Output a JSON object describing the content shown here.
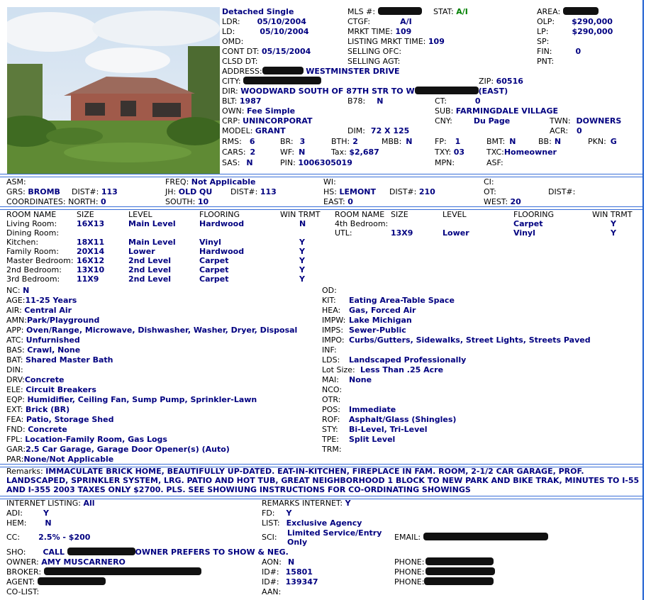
{
  "header": {
    "type": "Detached Single",
    "mls_label": "MLS #:",
    "stat_label": "STAT:",
    "stat_value": "A/I",
    "area_label": "AREA:",
    "ldr_label": "LDR:",
    "ldr_value": "05/10/2004",
    "ctgf_label": "CTGF:",
    "ctgf_value": "A/I",
    "olp_label": "OLP:",
    "olp_value": "$290,000",
    "ld_label": "LD:",
    "ld_value": "05/10/2004",
    "mrkt_label": "MRKT TIME:",
    "mrkt_value": "109",
    "lp_label": "LP:",
    "lp_value": "$290,000",
    "omd_label": "OMD:",
    "lmt_label": "LISTING MRKT TIME:",
    "lmt_value": "109",
    "sp_label": "SP:",
    "cont_label": "CONT DT:",
    "cont_value": "05/15/2004",
    "sofc_label": "SELLING OFC:",
    "fin_label": "FIN:",
    "fin_value": "0",
    "clsd_label": "CLSD DT:",
    "sagt_label": "SELLING AGT:",
    "pnt_label": "PNT:",
    "address_label": "ADDRESS:",
    "address_value": "WESTMINSTER DRIVE",
    "city_label": "CITY:",
    "zip_label": "ZIP:",
    "zip_value": "60516",
    "dir_label": "DIR:",
    "dir_value": "WOODWARD SOUTH OF 87TH STR TO W",
    "dir_end": "(EAST)",
    "blt_label": "BLT:",
    "blt_value": "1987",
    "b78_label": "B78:",
    "b78_value": "N",
    "ct_label": "CT:",
    "ct_value": "0",
    "own_label": "OWN:",
    "own_value": "Fee Simple",
    "sub_label": "SUB:",
    "sub_value": "FARMINGDALE VILLAGE",
    "crp_label": "CRP:",
    "crp_value": "UNINCORPORAT",
    "cny_label": "CNY:",
    "cny_value": "Du Page",
    "twn_label": "TWN:",
    "twn_value": "DOWNERS",
    "model_label": "MODEL:",
    "model_value": "GRANT",
    "dim_label": "DIM:",
    "dim_value": "72 X 125",
    "acr_label": "ACR:",
    "acr_value": "0",
    "rms_label": "RMS:",
    "rms_value": "6",
    "br_label": "BR:",
    "br_value": "3",
    "bth_label": "BTH:",
    "bth_value": "2",
    "mbb_label": "MBB:",
    "mbb_value": "N",
    "fp_label": "FP:",
    "fp_value": "1",
    "bmt_label": "BMT:",
    "bmt_value": "N",
    "bb_label": "BB:",
    "bb_value": "N",
    "pkn_label": "PKN:",
    "pkn_value": "G",
    "cars_label": "CARS:",
    "cars_value": "2",
    "wf_label": "WF:",
    "wf_value": "N",
    "tax_label": "Tax:",
    "tax_value": "$2,687",
    "txy_label": "TXY:",
    "txy_value": "03",
    "txc_label": "TXC:",
    "txc_value": "Homeowner",
    "sas_label": "SAS:",
    "sas_value": "N",
    "pin_label": "PIN:",
    "pin_value": "1006305019",
    "mpn_label": "MPN:",
    "asf_label": "ASF:"
  },
  "school": {
    "asm_label": "ASM:",
    "freq_label": "FREQ:",
    "freq_value": "Not Applicable",
    "wi_label": "WI:",
    "ci_label": "CI:",
    "grs_label": "GRS:",
    "grs_value": "BROMB",
    "dist_label": "DIST#:",
    "grs_dist": "113",
    "jh_label": "JH:",
    "jh_value": "OLD QU",
    "jh_dist": "113",
    "hs_label": "HS:",
    "hs_value": "LEMONT",
    "hs_dist": "210",
    "ot_label": "OT:",
    "ot_dist_label": "DIST#:",
    "coord_label": "COORDINATES: NORTH:",
    "north_value": "0",
    "south_label": "SOUTH:",
    "south_value": "10",
    "east_label": "EAST:",
    "east_value": "0",
    "west_label": "WEST:",
    "west_value": "20"
  },
  "rooms": {
    "headers": [
      "ROOM NAME",
      "SIZE",
      "LEVEL",
      "FLOORING",
      "WIN TRMT"
    ],
    "left": [
      {
        "name": "Living Room:",
        "size": "16X13",
        "level": "Main Level",
        "floor": "Hardwood",
        "win": "N"
      },
      {
        "name": "Dining Room:",
        "size": "",
        "level": "",
        "floor": "",
        "win": ""
      },
      {
        "name": "Kitchen:",
        "size": "18X11",
        "level": "Main Level",
        "floor": "Vinyl",
        "win": "Y"
      },
      {
        "name": "Family Room:",
        "size": "20X14",
        "level": "Lower",
        "floor": "Hardwood",
        "win": "Y"
      },
      {
        "name": "Master Bedroom:",
        "size": "16X12",
        "level": "2nd Level",
        "floor": "Carpet",
        "win": "Y"
      },
      {
        "name": "2nd Bedroom:",
        "size": "13X10",
        "level": "2nd Level",
        "floor": "Carpet",
        "win": "Y"
      },
      {
        "name": "3rd Bedroom:",
        "size": "11X9",
        "level": "2nd Level",
        "floor": "Carpet",
        "win": "Y"
      }
    ],
    "right": [
      {
        "name": "4th Bedroom:",
        "size": "",
        "level": "",
        "floor": "Carpet",
        "win": "Y"
      },
      {
        "name": "UTL:",
        "size": "13X9",
        "level": "Lower",
        "floor": "Vinyl",
        "win": "Y"
      }
    ]
  },
  "features_left": [
    {
      "label": "NC:",
      "value": "N"
    },
    {
      "label": "AGE:",
      "value": "11-25 Years"
    },
    {
      "label": "AIR:",
      "value": "Central Air"
    },
    {
      "label": "AMN:",
      "value": "Park/Playground"
    },
    {
      "label": "APP:",
      "value": "Oven/Range, Microwave, Dishwasher, Washer, Dryer, Disposal"
    },
    {
      "label": "ATC:",
      "value": "Unfurnished"
    },
    {
      "label": "BAS:",
      "value": "Crawl, None"
    },
    {
      "label": "BAT:",
      "value": "Shared Master Bath"
    },
    {
      "label": "DIN:",
      "value": ""
    },
    {
      "label": "DRV:",
      "value": "Concrete"
    },
    {
      "label": "ELE:",
      "value": "Circuit Breakers"
    },
    {
      "label": "EQP:",
      "value": "Humidifier, Ceiling Fan, Sump Pump, Sprinkler-Lawn"
    },
    {
      "label": "EXT:",
      "value": "Brick (BR)"
    },
    {
      "label": "FEA:",
      "value": "Patio, Storage Shed"
    },
    {
      "label": "FND:",
      "value": "Concrete"
    },
    {
      "label": "FPL:",
      "value": "Location-Family Room, Gas Logs"
    },
    {
      "label": "GAR:",
      "value": "2.5 Car Garage, Garage Door Opener(s) (Auto)"
    },
    {
      "label": "PAR:",
      "value": "None/Not Applicable"
    }
  ],
  "features_right": [
    {
      "label": "OD:",
      "value": ""
    },
    {
      "label": "KIT:",
      "value": "Eating Area-Table Space"
    },
    {
      "label": "HEA:",
      "value": "Gas, Forced Air"
    },
    {
      "label": "IMPW:",
      "value": "Lake Michigan"
    },
    {
      "label": "IMPS:",
      "value": "Sewer-Public"
    },
    {
      "label": "IMPO:",
      "value": "Curbs/Gutters, Sidewalks, Street Lights, Streets Paved"
    },
    {
      "label": "INF:",
      "value": ""
    },
    {
      "label": "LDS:",
      "value": "Landscaped Professionally"
    },
    {
      "label": "Lot Size:",
      "value": "Less Than .25 Acre"
    },
    {
      "label": "MAI:",
      "value": "None"
    },
    {
      "label": "NCO:",
      "value": ""
    },
    {
      "label": "OTR:",
      "value": ""
    },
    {
      "label": "POS:",
      "value": "Immediate"
    },
    {
      "label": "ROF:",
      "value": "Asphalt/Glass (Shingles)"
    },
    {
      "label": "STY:",
      "value": "Bi-Level, Tri-Level"
    },
    {
      "label": "TPE:",
      "value": "Split Level"
    },
    {
      "label": "TRM:",
      "value": ""
    }
  ],
  "remarks": {
    "label": "Remarks:",
    "text": "IMMACULATE BRICK HOME, BEAUTIFULLY UP-DATED. EAT-IN-KITCHEN, FIREPLACE IN FAM. ROOM, 2-1/2 CAR GARAGE, PROF. LANDSCAPED, SPRINKLER SYSTEM, LRG. PATIO AND HOT TUB, GREAT NEIGHBORHOOD 1 BLOCK TO NEW PARK AND BIKE TRAK, MINUTES TO I-55 AND I-355 2003 TAXES ONLY $2700. PLS. SEE SHOWIUNG INSTRUCTIONS FOR CO-ORDINATING SHOWINGS"
  },
  "listing": {
    "internet_label": "INTERNET LISTING:",
    "internet_value": "All",
    "remarks_internet_label": "REMARKS INTERNET:",
    "remarks_internet_value": "Y",
    "adi_label": "ADI:",
    "adi_value": "Y",
    "fd_label": "FD:",
    "fd_value": "Y",
    "hem_label": "HEM:",
    "hem_value": "N",
    "list_label": "LIST:",
    "list_value": "Exclusive Agency",
    "cc_label": "CC:",
    "cc_value": "2.5% - $200",
    "sci_label": "SCI:",
    "sci_value_1": "Limited Service/Entry",
    "sci_value_2": "Only",
    "email_label": "EMAIL:",
    "sho_label": "SHO:",
    "sho_value_start": "CALL",
    "sho_value_end": "OWNER PREFERS TO SHOW & NEG.",
    "owner_label": "OWNER:",
    "owner_value": "AMY MUSCARNERO",
    "aon_label": "AON:",
    "aon_value": "N",
    "phone_label": "PHONE:",
    "broker_label": "BROKER:",
    "id_label": "ID#:",
    "broker_id": "15801",
    "agent_label": "AGENT:",
    "agent_id": "139347",
    "colist_label": "CO-LIST:",
    "aan_label": "AAN:"
  },
  "colors": {
    "label_text": "#000000",
    "value_text": "#000080",
    "status_green": "#008000",
    "rule_blue": "#3a6fd8"
  }
}
